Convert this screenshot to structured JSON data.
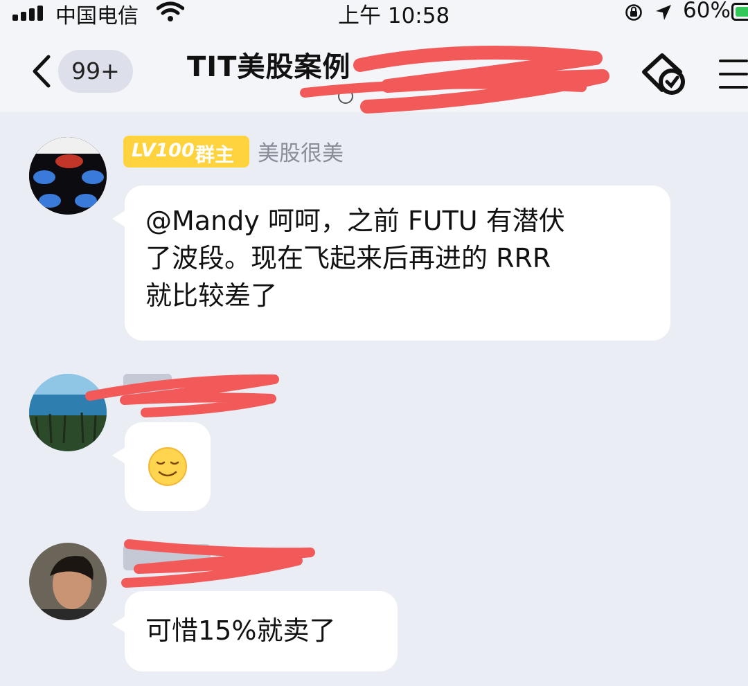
{
  "status_bar": {
    "carrier": "中国电信",
    "time": "上午 10:58",
    "battery_percent": "60%",
    "battery_level": 0.6,
    "icons": [
      "signal-icon",
      "wifi-icon",
      "orientation-lock-icon",
      "location-arrow-icon",
      "battery-icon"
    ]
  },
  "nav": {
    "back_badge": "99+",
    "title": "TIT美股案例"
  },
  "messages": [
    {
      "level": "LV100",
      "role": "群主",
      "sender": "美股很美",
      "text": "@Mandy 呵呵，之前FUTU有潜伏了波段。现在飞起来后再进的RRR就比较差了",
      "text_lines": [
        "@Mandy  呵呵，之前 FUTU 有潜伏",
        "了波段。现在飞起来后再进的 RRR",
        "就比较差了"
      ]
    },
    {
      "text": "😌"
    },
    {
      "text": "可惜15%就卖了"
    }
  ],
  "colors": {
    "background": "#ebedf5",
    "bubble": "#ffffff",
    "level_badge": "#ffd33d",
    "redaction": "#f25a5a"
  }
}
